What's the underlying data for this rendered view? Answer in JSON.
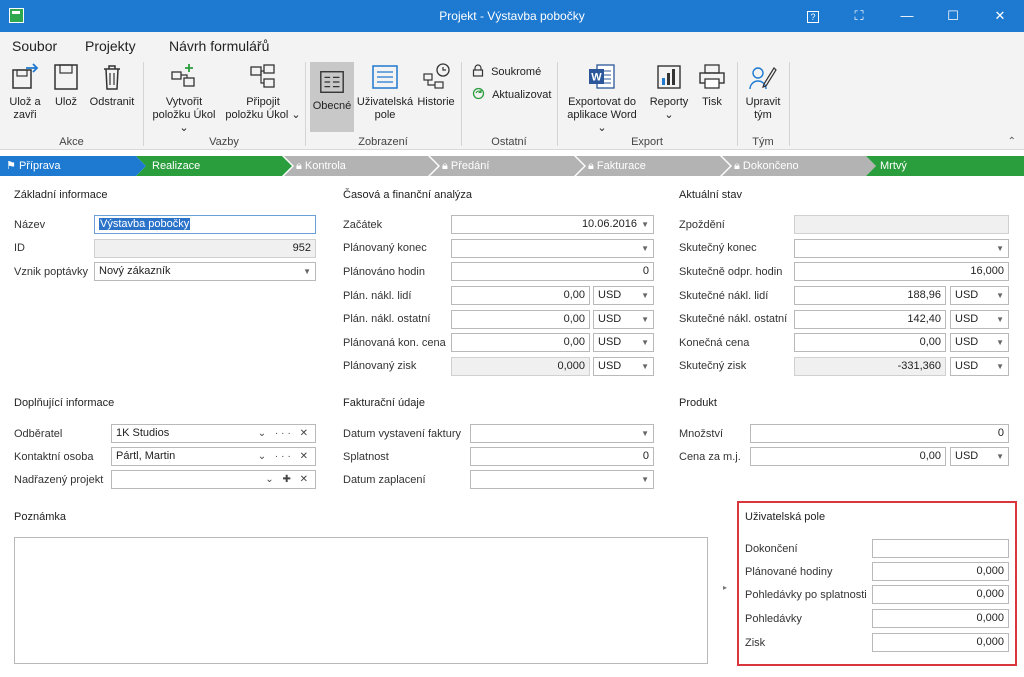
{
  "titlebar": {
    "title": "Projekt - Výstavba pobočky",
    "help_glyph": "?",
    "extra_glyph": "⛶",
    "minimize_glyph": "—",
    "maximize_glyph": "☐",
    "close_glyph": "✕"
  },
  "menu": {
    "tabs": [
      "Soubor",
      "Projekty",
      "Návrh formulářů"
    ],
    "active": "Projekty"
  },
  "ribbon": {
    "groups": {
      "akce": "Akce",
      "vazby": "Vazby",
      "zobrazeni": "Zobrazení",
      "ostatni": "Ostatní",
      "export": "Export",
      "tym": "Tým"
    },
    "buttons": {
      "save_close": [
        "Ulož a",
        "zavři"
      ],
      "save": "Ulož",
      "delete": "Odstranit",
      "create_task": [
        "Vytvořit",
        "položku Úkol"
      ],
      "attach_task": [
        "Připojit",
        "položku Úkol"
      ],
      "general": "Obecné",
      "user_fields": [
        "Uživatelská",
        "pole"
      ],
      "history": "Historie",
      "private": "Soukromé",
      "refresh": "Aktualizovat",
      "export_word": [
        "Exportovat do",
        "aplikace Word"
      ],
      "reports": "Reporty",
      "print": "Tisk",
      "edit_team": [
        "Upravit",
        "tým"
      ]
    },
    "dropdown_glyph": "⌄",
    "collapse_glyph": "⌃"
  },
  "stages": [
    {
      "label": "Přípravа",
      "locked": false,
      "flag": true
    },
    {
      "label": "Realizace",
      "locked": false,
      "flag": false
    },
    {
      "label": "Kontrola",
      "locked": true,
      "flag": false
    },
    {
      "label": "Předání",
      "locked": true,
      "flag": false
    },
    {
      "label": "Fakturace",
      "locked": true,
      "flag": false
    },
    {
      "label": "Dokončeno",
      "locked": true,
      "flag": false
    },
    {
      "label": "Mrtvý",
      "locked": false,
      "flag": false
    }
  ],
  "basic": {
    "title": "Základní informace",
    "name_label": "Název",
    "name_value": "Výstavba pobočky",
    "id_label": "ID",
    "id_value": "952",
    "origin_label": "Vznik poptávky",
    "origin_value": "Nový zákazník"
  },
  "time_fin": {
    "title": "Časová a finanční analýza",
    "start_label": "Začátek",
    "start_value": "10.06.2016",
    "planned_end_label": "Plánovaný konec",
    "planned_end_value": "",
    "planned_hours_label": "Plánováno hodin",
    "planned_hours_value": "0",
    "plan_people_label": "Plán. nákl. lidí",
    "plan_people_value": "0,00",
    "plan_people_cur": "USD",
    "plan_other_label": "Plán. nákl. ostatní",
    "plan_other_value": "0,00",
    "plan_other_cur": "USD",
    "plan_price_label": "Plánovaná kon. cena",
    "plan_price_value": "0,00",
    "plan_price_cur": "USD",
    "plan_profit_label": "Plánovaný zisk",
    "plan_profit_value": "0,000",
    "plan_profit_cur": "USD"
  },
  "current": {
    "title": "Aktuální stav",
    "delay_label": "Zpoždění",
    "delay_value": "",
    "actual_end_label": "Skutečný konec",
    "actual_end_value": "",
    "actual_hours_label": "Skutečně odpr. hodin",
    "actual_hours_value": "16,000",
    "actual_people_label": "Skutečné nákl. lidí",
    "actual_people_value": "188,96",
    "actual_people_cur": "USD",
    "actual_other_label": "Skutečné nákl. ostatní",
    "actual_other_value": "142,40",
    "actual_other_cur": "USD",
    "final_price_label": "Konečná cena",
    "final_price_value": "0,00",
    "final_price_cur": "USD",
    "actual_profit_label": "Skutečný zisk",
    "actual_profit_value": "-331,360",
    "actual_profit_cur": "USD"
  },
  "extra": {
    "title": "Doplňující informace",
    "customer_label": "Odběratel",
    "customer_value": "1K Studios",
    "contact_label": "Kontaktní osoba",
    "contact_value": "Pártl, Martin",
    "parent_label": "Nadřazený projekt",
    "parent_value": "",
    "acts1": "⌄ ··· ✕",
    "acts2": "⌄ ··· ✕",
    "acts3": "⌄ ✚ ✕"
  },
  "billing": {
    "title": "Fakturační údaje",
    "issue_label": "Datum vystavení faktury",
    "issue_value": "",
    "due_label": "Splatnost",
    "due_value": "0",
    "paid_label": "Datum zaplacení",
    "paid_value": ""
  },
  "product": {
    "title": "Produkt",
    "qty_label": "Množství",
    "qty_value": "0",
    "unit_price_label": "Cena za m.j.",
    "unit_price_value": "0,00",
    "unit_price_cur": "USD"
  },
  "note": {
    "title": "Poznámka"
  },
  "custom_fields": {
    "title": "Uživatelská pole",
    "done_label": "Dokončení",
    "done_value": "",
    "planned_hours_label": "Plánované hodiny",
    "planned_hours_value": "0,000",
    "overdue_label": "Pohledávky po splatnosti",
    "overdue_value": "0,000",
    "receivables_label": "Pohledávky",
    "receivables_value": "0,000",
    "profit_label": "Zisk",
    "profit_value": "0,000"
  },
  "colors": {
    "accent": "#1e79d0",
    "stage_active": "#1e79d0",
    "stage_done": "#2a9d3d",
    "stage_locked": "#b3b3b3",
    "highlight_border": "#d9363e"
  }
}
